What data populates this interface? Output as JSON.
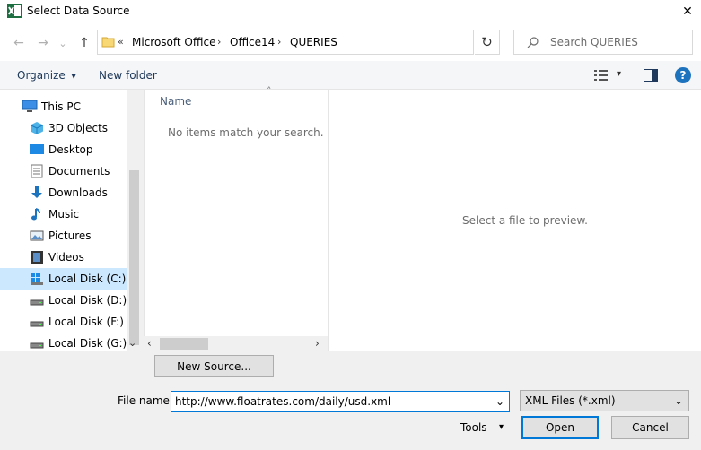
{
  "window": {
    "title": "Select Data Source",
    "close_glyph": "✕"
  },
  "nav": {
    "back": "←",
    "forward": "→",
    "recent": "⌄",
    "up": "↑"
  },
  "address": {
    "overflow": "«",
    "crumbs": [
      "Microsoft Office",
      "Office14",
      "QUERIES"
    ],
    "separator": "›",
    "dropdown": "⌄",
    "refresh": "↻"
  },
  "search": {
    "placeholder": "Search QUERIES"
  },
  "commands": {
    "organize": "Organize",
    "organize_arrow": "▾",
    "new_folder": "New folder",
    "view_arrow": "▾",
    "help": "?"
  },
  "sidebar": {
    "items": [
      {
        "label": "This PC",
        "icon": "pc-icon"
      },
      {
        "label": "3D Objects",
        "icon": "3d-objects-icon"
      },
      {
        "label": "Desktop",
        "icon": "desktop-icon"
      },
      {
        "label": "Documents",
        "icon": "documents-icon"
      },
      {
        "label": "Downloads",
        "icon": "downloads-icon"
      },
      {
        "label": "Music",
        "icon": "music-icon"
      },
      {
        "label": "Pictures",
        "icon": "pictures-icon"
      },
      {
        "label": "Videos",
        "icon": "videos-icon"
      },
      {
        "label": "Local Disk (C:)",
        "icon": "local-disk-icon",
        "selected": true
      },
      {
        "label": "Local Disk (D:)",
        "icon": "drive-icon"
      },
      {
        "label": "Local Disk (F:)",
        "icon": "drive-icon"
      },
      {
        "label": "Local Disk (G:)",
        "icon": "drive-icon"
      }
    ],
    "scroll_down": "⌄"
  },
  "filelist": {
    "column_name": "Name",
    "sort_indicator": "˄",
    "empty_message": "No items match your search.",
    "scroll_left": "‹",
    "scroll_right": "›"
  },
  "preview": {
    "message": "Select a file to preview."
  },
  "bottom": {
    "new_source": "New Source...",
    "file_name_label": "File name:",
    "file_name_value": "http://www.floatrates.com/daily/usd.xml",
    "dropdown": "⌄",
    "file_type": "XML Files (*.xml)",
    "tools": "Tools",
    "tools_arrow": "▾",
    "open": "Open",
    "cancel": "Cancel"
  },
  "colors": {
    "accent": "#0078d7",
    "selection": "#cce8ff",
    "excel_green": "#1d6f42"
  }
}
